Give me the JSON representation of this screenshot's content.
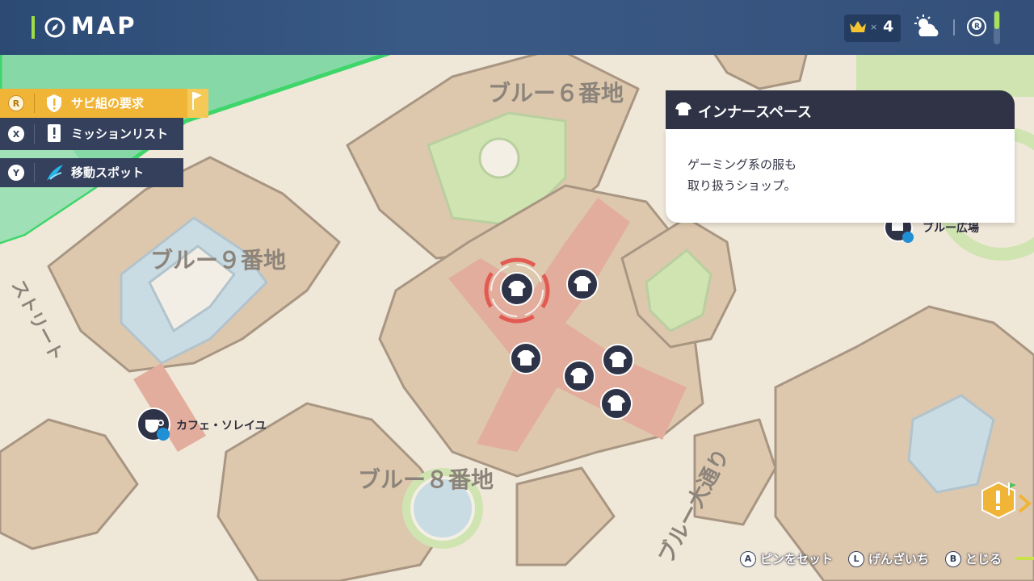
{
  "header": {
    "title": "MAP",
    "crown_count": "4",
    "crown_times": "×"
  },
  "menu": [
    {
      "button": "R",
      "label": "サビ組の要求",
      "icon": "exclamation-shield-icon"
    },
    {
      "button": "X",
      "label": "ミッションリスト",
      "icon": "mission-list-icon"
    },
    {
      "button": "Y",
      "label": "移動スポット",
      "icon": "wing-icon"
    }
  ],
  "info_card": {
    "icon": "shirt-icon",
    "title": "インナースペース",
    "description_line1": "ゲーミング系の服も",
    "description_line2": "取り扱うショップ。"
  },
  "map": {
    "districts": [
      "ブルー６番地",
      "ブルー９番地",
      "ブルー８番地"
    ],
    "street": "ブルー大通り",
    "street_left": "ストリート",
    "spots": [
      {
        "label": "カフェ・ソレイユ",
        "icon": "coffee-cup-icon"
      },
      {
        "label": "ブルー広場",
        "icon": "plaza-icon"
      }
    ],
    "shop_markers": 6,
    "colors": {
      "ground": "#efe7d8",
      "building": "#ddc8ae",
      "road_highlight": "#e2ad9c",
      "park": "#cfe4b0",
      "water": "#c9dbe3",
      "zone_border": "#3ed66a"
    }
  },
  "hints": [
    {
      "button": "A",
      "label": "ピンをセット"
    },
    {
      "button": "L",
      "label": "げんざいち"
    },
    {
      "button": "B",
      "label": "とじる"
    }
  ]
}
